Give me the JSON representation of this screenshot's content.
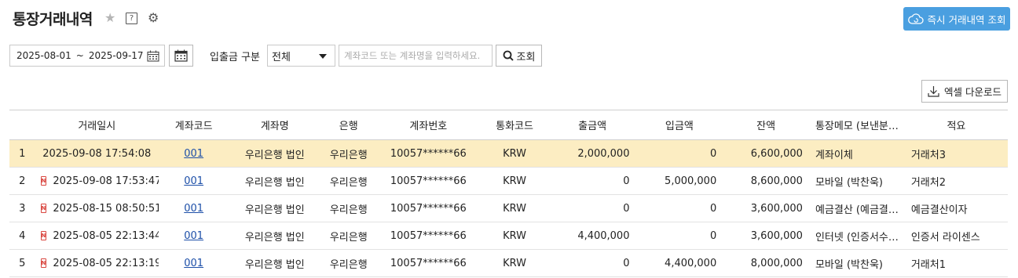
{
  "header": {
    "title": "통장거래내역",
    "help_icon_text": "?",
    "realtime_button": "즉시 거래내역 조회"
  },
  "filters": {
    "date_from": "2025-08-01",
    "date_sep": "~",
    "date_to": "2025-09-17",
    "type_label": "입출금 구분",
    "type_value": "전체",
    "search_placeholder": "계좌코드 또는 계좌명을 입력하세요.",
    "search_button": "조회"
  },
  "toolbar": {
    "excel_download": "엑셀 다운로드"
  },
  "table": {
    "columns": [
      "",
      "거래일시",
      "계좌코드",
      "계좌명",
      "은행",
      "계좌번호",
      "통화코드",
      "출금액",
      "입금액",
      "잔액",
      "통장메모 (보낸분…",
      "적요"
    ],
    "rows": [
      {
        "no": "1",
        "datetime": "2025-09-08 17:54:08",
        "badge": "",
        "code": "001",
        "account_name": "우리은행 법인",
        "bank": "우리은행",
        "account_no": "10057******66",
        "currency": "KRW",
        "withdrawal": "2,000,000",
        "deposit": "0",
        "balance": "6,600,000",
        "memo": "계좌이체",
        "summary": "거래처3"
      },
      {
        "no": "2",
        "datetime": "2025-09-08 17:53:47",
        "badge": "N",
        "code": "001",
        "account_name": "우리은행 법인",
        "bank": "우리은행",
        "account_no": "10057******66",
        "currency": "KRW",
        "withdrawal": "0",
        "deposit": "5,000,000",
        "balance": "8,600,000",
        "memo": "모바일 (박찬욱)",
        "summary": "거래처2"
      },
      {
        "no": "3",
        "datetime": "2025-08-15 08:50:51",
        "badge": "N",
        "code": "001",
        "account_name": "우리은행 법인",
        "bank": "우리은행",
        "account_no": "10057******66",
        "currency": "KRW",
        "withdrawal": "0",
        "deposit": "0",
        "balance": "3,600,000",
        "memo": "예금결산 (예금결…",
        "summary": "예금결산이자"
      },
      {
        "no": "4",
        "datetime": "2025-08-05 22:13:44",
        "badge": "N",
        "code": "001",
        "account_name": "우리은행 법인",
        "bank": "우리은행",
        "account_no": "10057******66",
        "currency": "KRW",
        "withdrawal": "4,400,000",
        "deposit": "0",
        "balance": "3,600,000",
        "memo": "인터넷 (인증서수…",
        "summary": "인증서 라이센스"
      },
      {
        "no": "5",
        "datetime": "2025-08-05 22:13:19",
        "badge": "N",
        "code": "001",
        "account_name": "우리은행 법인",
        "bank": "우리은행",
        "account_no": "10057******66",
        "currency": "KRW",
        "withdrawal": "0",
        "deposit": "4,400,000",
        "balance": "8,000,000",
        "memo": "모바일 (박찬욱)",
        "summary": "거래처1"
      }
    ]
  }
}
